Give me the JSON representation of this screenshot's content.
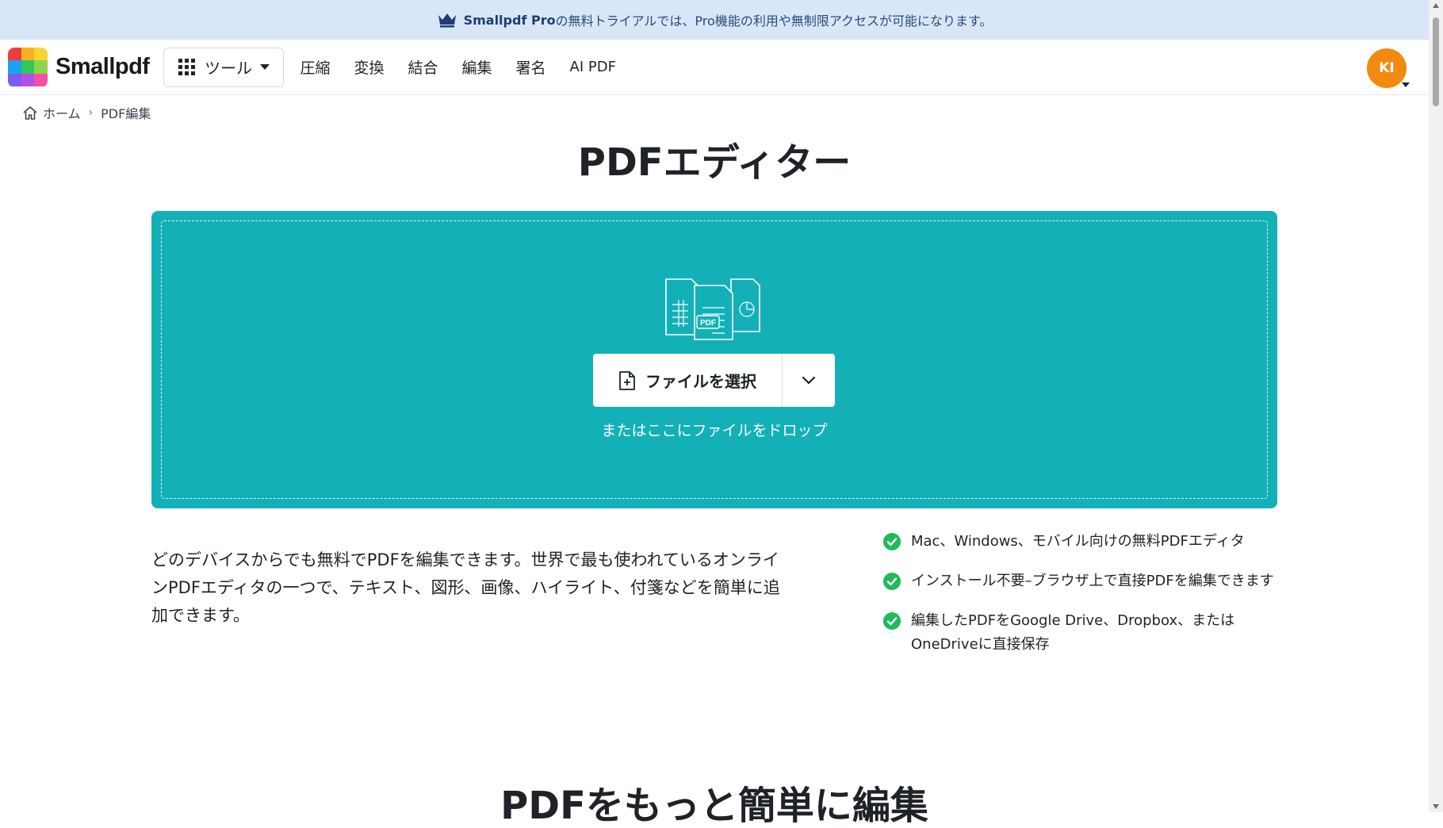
{
  "promo": {
    "brand": "Smallpdf Pro",
    "text": "の無料トライアルでは、Pro機能の利用や無制限アクセスが可能になります。"
  },
  "header": {
    "logo_text": "Smallpdf",
    "tools_label": "ツール",
    "nav": [
      "圧縮",
      "変換",
      "結合",
      "編集",
      "署名",
      "AI PDF"
    ],
    "avatar_initials": "KI"
  },
  "breadcrumb": {
    "home": "ホーム",
    "separator": "›",
    "current": "PDF編集"
  },
  "page_title": "PDFエディター",
  "dropzone": {
    "choose_label": "ファイルを選択",
    "drop_hint": "またはここにファイルをドロップ",
    "illustration_label": "PDF"
  },
  "description": "どのデバイスからでも無料でPDFを編集できます。世界で最も使われているオンラインPDFエディタの一つで、テキスト、図形、画像、ハイライト、付箋などを簡単に追加できます。",
  "features": [
    "Mac、Windows、モバイル向けの無料PDFエディタ",
    "インストール不要–ブラウザ上で直接PDFを編集できます",
    "編集したPDFをGoogle Drive、Dropbox、またはOneDriveに直接保存"
  ],
  "section_title": "PDFをもっと簡単に編集",
  "colors": {
    "banner_bg": "#d8e6f8",
    "dropzone_bg": "#13b0b8",
    "avatar_bg": "#f28a0f",
    "check_green": "#1fba5a"
  }
}
